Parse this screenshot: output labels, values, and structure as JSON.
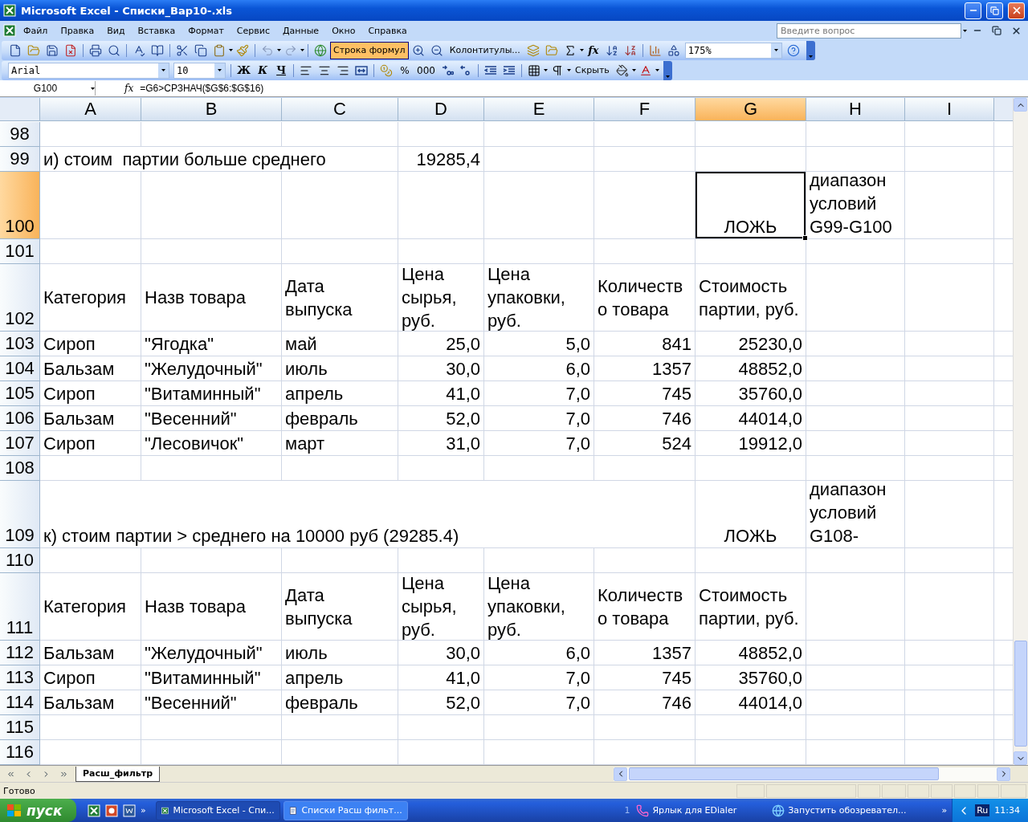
{
  "window": {
    "title": "Microsoft Excel - Списки_Вар10-.xls"
  },
  "menu": {
    "items": [
      "Файл",
      "Правка",
      "Вид",
      "Вставка",
      "Формат",
      "Сервис",
      "Данные",
      "Окно",
      "Справка"
    ],
    "help_search": {
      "placeholder": "Введите вопрос"
    }
  },
  "standard_toolbar": {
    "formula_bar_button": {
      "label": "Строка формул",
      "selected": true
    },
    "headers_button": "Колонтитулы...",
    "function_button": "fx",
    "zoom": "175%"
  },
  "formatting_toolbar": {
    "font": "Arial",
    "size": "10",
    "bold": "Ж",
    "italic": "К",
    "underline": "Ч",
    "percent": "%",
    "thousands": "000",
    "hide_button": "Скрыть"
  },
  "formula_bar": {
    "name_box": "G100",
    "fx": "fx",
    "formula": "=G6>СРЗНАЧ($G$6:$G$16)"
  },
  "sheet": {
    "columns": [
      {
        "label": "A",
        "selected": false
      },
      {
        "label": "B",
        "selected": false
      },
      {
        "label": "C",
        "selected": false
      },
      {
        "label": "D",
        "selected": false
      },
      {
        "label": "E",
        "selected": false
      },
      {
        "label": "F",
        "selected": false
      },
      {
        "label": "G",
        "selected": true
      },
      {
        "label": "H",
        "selected": false
      },
      {
        "label": "I",
        "selected": false
      }
    ],
    "rows": [
      {
        "number": "98",
        "selected": false,
        "cells": []
      },
      {
        "number": "99",
        "selected": false,
        "cells": [
          {
            "kind": "text",
            "text": "и) стоим  партии больше среднего"
          },
          {
            "kind": "empty",
            "text": ""
          },
          {
            "kind": "empty",
            "text": ""
          },
          {
            "kind": "number",
            "text": "19285,4"
          }
        ]
      },
      {
        "number": "100",
        "selected": true,
        "cells": [
          {
            "kind": "empty",
            "text": ""
          },
          {
            "kind": "empty",
            "text": ""
          },
          {
            "kind": "empty",
            "text": ""
          },
          {
            "kind": "empty",
            "text": ""
          },
          {
            "kind": "empty",
            "text": ""
          },
          {
            "kind": "empty",
            "text": ""
          },
          {
            "kind": "logical",
            "text": "ЛОЖЬ"
          },
          {
            "kind": "wrapped",
            "text": "диапазон условий G99-G100"
          }
        ]
      },
      {
        "number": "101",
        "selected": false,
        "cells": []
      },
      {
        "number": "102",
        "selected": false,
        "cells": [
          {
            "kind": "header",
            "text": "Категория"
          },
          {
            "kind": "header",
            "text": "Назв товара"
          },
          {
            "kind": "header",
            "text": "Дата выпуска"
          },
          {
            "kind": "header",
            "text": "Цена сырья, руб."
          },
          {
            "kind": "header",
            "text": "Цена упаковки, руб."
          },
          {
            "kind": "header",
            "text": "Количеств о товара"
          },
          {
            "kind": "header",
            "text": "Стоимость партии, руб."
          }
        ]
      },
      {
        "number": "103",
        "selected": false,
        "cells": [
          {
            "kind": "text",
            "text": "Сироп"
          },
          {
            "kind": "text",
            "text": "\"Ягодка\""
          },
          {
            "kind": "text",
            "text": "май"
          },
          {
            "kind": "number",
            "text": "25,0"
          },
          {
            "kind": "number",
            "text": "5,0"
          },
          {
            "kind": "number",
            "text": "841"
          },
          {
            "kind": "number",
            "text": "25230,0"
          }
        ]
      },
      {
        "number": "104",
        "selected": false,
        "cells": [
          {
            "kind": "text",
            "text": "Бальзам"
          },
          {
            "kind": "text",
            "text": "\"Желудочный\""
          },
          {
            "kind": "text",
            "text": "июль"
          },
          {
            "kind": "number",
            "text": "30,0"
          },
          {
            "kind": "number",
            "text": "6,0"
          },
          {
            "kind": "number",
            "text": "1357"
          },
          {
            "kind": "number",
            "text": "48852,0"
          }
        ]
      },
      {
        "number": "105",
        "selected": false,
        "cells": [
          {
            "kind": "text",
            "text": "Сироп"
          },
          {
            "kind": "text",
            "text": "\"Витаминный\""
          },
          {
            "kind": "text",
            "text": "апрель"
          },
          {
            "kind": "number",
            "text": "41,0"
          },
          {
            "kind": "number",
            "text": "7,0"
          },
          {
            "kind": "number",
            "text": "745"
          },
          {
            "kind": "number",
            "text": "35760,0"
          }
        ]
      },
      {
        "number": "106",
        "selected": false,
        "cells": [
          {
            "kind": "text",
            "text": "Бальзам"
          },
          {
            "kind": "text",
            "text": "\"Весенний\""
          },
          {
            "kind": "text",
            "text": "февраль"
          },
          {
            "kind": "number",
            "text": "52,0"
          },
          {
            "kind": "number",
            "text": "7,0"
          },
          {
            "kind": "number",
            "text": "746"
          },
          {
            "kind": "number",
            "text": "44014,0"
          }
        ]
      },
      {
        "number": "107",
        "selected": false,
        "cells": [
          {
            "kind": "text",
            "text": "Сироп"
          },
          {
            "kind": "text",
            "text": "\"Лесовичок\""
          },
          {
            "kind": "text",
            "text": "март"
          },
          {
            "kind": "number",
            "text": "31,0"
          },
          {
            "kind": "number",
            "text": "7,0"
          },
          {
            "kind": "number",
            "text": "524"
          },
          {
            "kind": "number",
            "text": "19912,0"
          }
        ]
      },
      {
        "number": "108",
        "selected": false,
        "cells": []
      },
      {
        "number": "109",
        "selected": false,
        "cells": [
          {
            "kind": "text",
            "text": "к) стоим партии > среднего на 10000 руб (29285.4)"
          },
          {
            "kind": "empty",
            "text": ""
          },
          {
            "kind": "empty",
            "text": ""
          },
          {
            "kind": "empty",
            "text": ""
          },
          {
            "kind": "empty",
            "text": ""
          },
          {
            "kind": "empty",
            "text": ""
          },
          {
            "kind": "logical",
            "text": "ЛОЖЬ"
          },
          {
            "kind": "wrapped",
            "text": "диапазон условий G108-"
          }
        ]
      },
      {
        "number": "110",
        "selected": false,
        "cells": []
      },
      {
        "number": "111",
        "selected": false,
        "cells": [
          {
            "kind": "header",
            "text": "Категория"
          },
          {
            "kind": "header",
            "text": "Назв товара"
          },
          {
            "kind": "header",
            "text": "Дата выпуска"
          },
          {
            "kind": "header",
            "text": "Цена сырья, руб."
          },
          {
            "kind": "header",
            "text": "Цена упаковки, руб."
          },
          {
            "kind": "header",
            "text": "Количеств о товара"
          },
          {
            "kind": "header",
            "text": "Стоимость партии, руб."
          }
        ]
      },
      {
        "number": "112",
        "selected": false,
        "cells": [
          {
            "kind": "text",
            "text": "Бальзам"
          },
          {
            "kind": "text",
            "text": "\"Желудочный\""
          },
          {
            "kind": "text",
            "text": "июль"
          },
          {
            "kind": "number",
            "text": "30,0"
          },
          {
            "kind": "number",
            "text": "6,0"
          },
          {
            "kind": "number",
            "text": "1357"
          },
          {
            "kind": "number",
            "text": "48852,0"
          }
        ]
      },
      {
        "number": "113",
        "selected": false,
        "cells": [
          {
            "kind": "text",
            "text": "Сироп"
          },
          {
            "kind": "text",
            "text": "\"Витаминный\""
          },
          {
            "kind": "text",
            "text": "апрель"
          },
          {
            "kind": "number",
            "text": "41,0"
          },
          {
            "kind": "number",
            "text": "7,0"
          },
          {
            "kind": "number",
            "text": "745"
          },
          {
            "kind": "number",
            "text": "35760,0"
          }
        ]
      },
      {
        "number": "114",
        "selected": false,
        "cells": [
          {
            "kind": "text",
            "text": "Бальзам"
          },
          {
            "kind": "text",
            "text": "\"Весенний\""
          },
          {
            "kind": "text",
            "text": "февраль"
          },
          {
            "kind": "number",
            "text": "52,0"
          },
          {
            "kind": "number",
            "text": "7,0"
          },
          {
            "kind": "number",
            "text": "746"
          },
          {
            "kind": "number",
            "text": "44014,0"
          }
        ]
      },
      {
        "number": "115",
        "selected": false,
        "cells": []
      },
      {
        "number": "116",
        "selected": false,
        "cells": []
      }
    ]
  },
  "sheet_tabs": [
    {
      "label": "Расш_фильтр",
      "selected": true
    }
  ],
  "status_bar": {
    "text": "Готово"
  },
  "taskbar": {
    "start": "пуск",
    "more": "»",
    "buttons": [
      {
        "label": "Microsoft Excel - Спи...",
        "kind": "excel",
        "selected": true
      },
      {
        "label": "Списки Расш фильт...",
        "kind": "word",
        "selected": false
      }
    ],
    "toolbar_number": "1",
    "links": [
      {
        "label": "Ярлык для EDialer",
        "kind": "dialer"
      },
      {
        "label": "Запустить обозревател...",
        "kind": "browser"
      }
    ],
    "tray_more": "»",
    "language": "Ru",
    "clock": "11:34"
  }
}
